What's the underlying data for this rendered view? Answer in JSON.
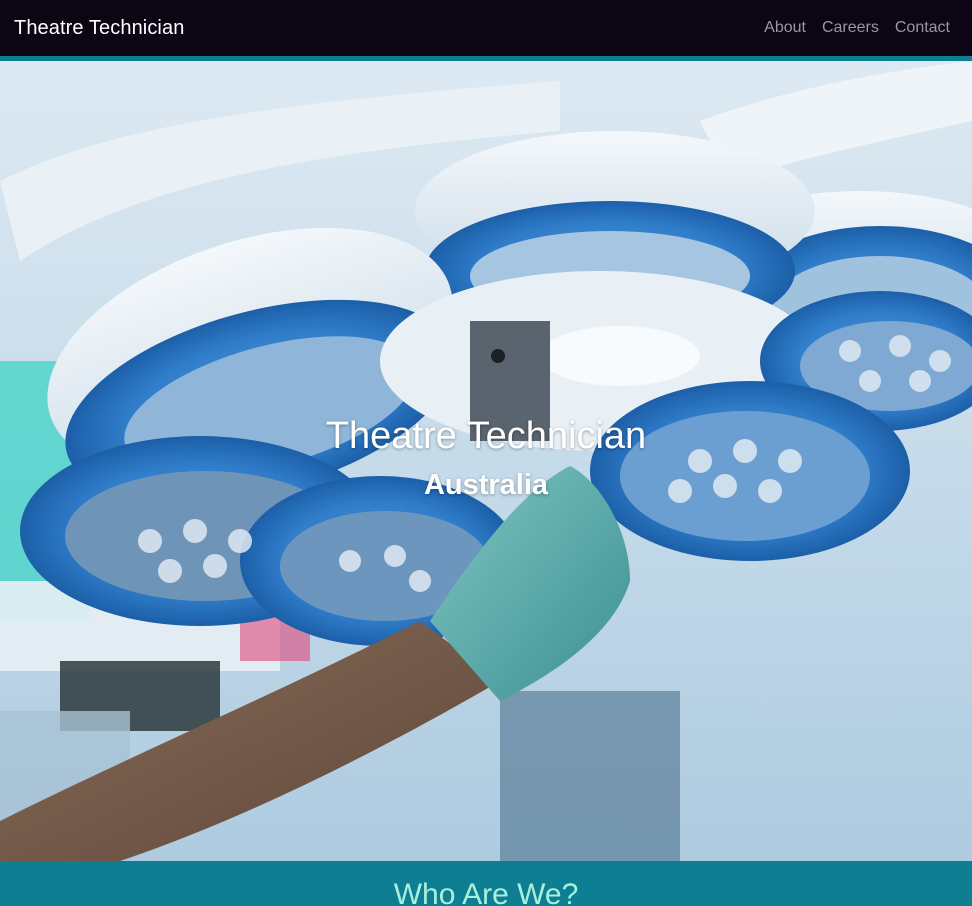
{
  "navbar": {
    "brand": "Theatre Technician",
    "links": [
      {
        "label": "About"
      },
      {
        "label": "Careers"
      },
      {
        "label": "Contact"
      }
    ]
  },
  "hero": {
    "title": "Theatre Technician",
    "subtitle": "Australia",
    "image_subject": "surgical-light-photo"
  },
  "about": {
    "heading": "Who Are We?"
  },
  "colors": {
    "navbar_bg": "#0b0514",
    "accent_teal": "#0e7f93",
    "heading_mint": "#a8f0dc",
    "nav_link": "#9a979e"
  }
}
